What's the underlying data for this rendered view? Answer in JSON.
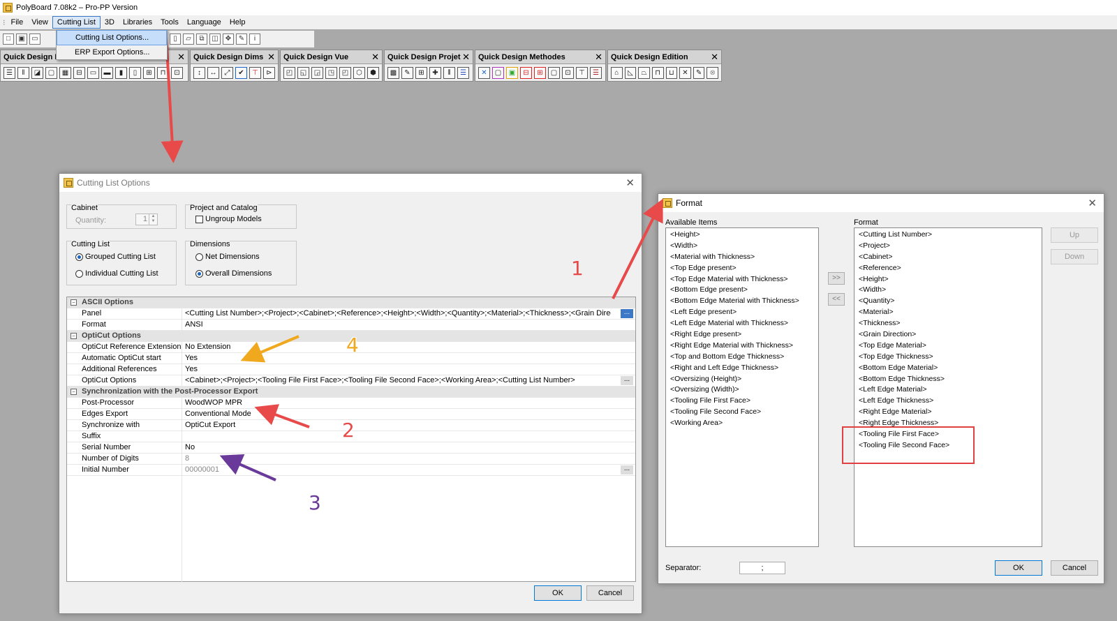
{
  "app": {
    "title": "PolyBoard 7.08k2 – Pro-PP Version"
  },
  "menu": {
    "items": [
      "File",
      "View",
      "Cutting List",
      "3D",
      "Libraries",
      "Tools",
      "Language",
      "Help"
    ],
    "open_menu_items": [
      "Cutting List Options...",
      "ERP Export Options..."
    ]
  },
  "quick_panels": [
    {
      "title": "Quick Design M",
      "icon_count": 13
    },
    {
      "title": "Quick Design Dims",
      "icon_count": 6
    },
    {
      "title": "Quick Design Vue",
      "icon_count": 7
    },
    {
      "title": "Quick Design Projet",
      "icon_count": 6
    },
    {
      "title": "Quick Design Methodes",
      "icon_count": 9
    },
    {
      "title": "Quick Design Edition",
      "icon_count": 8
    }
  ],
  "cutting_dialog": {
    "title": "Cutting List Options",
    "cabinet": {
      "group": "Cabinet",
      "quantity_label": "Quantity:",
      "quantity_value": "1"
    },
    "project_catalog": {
      "group": "Project and Catalog",
      "ungroup_label": "Ungroup Models"
    },
    "cutting_list": {
      "group": "Cutting List",
      "grouped": "Grouped Cutting List",
      "individual": "Individual Cutting List"
    },
    "dimensions": {
      "group": "Dimensions",
      "net": "Net Dimensions",
      "overall": "Overall Dimensions"
    },
    "grid": [
      {
        "section": "ASCII Options"
      },
      {
        "name": "Panel",
        "value": "<Cutting List Number>;<Project>;<Cabinet>;<Reference>;<Height>;<Width>;<Quantity>;<Material>;<Thickness>;<Grain Direct...",
        "dots": "...",
        "dots_blue": true
      },
      {
        "name": "Format",
        "value": "ANSI"
      },
      {
        "section": "OptiCut Options"
      },
      {
        "name": "OptiCut Reference Extension",
        "value": "No Extension"
      },
      {
        "name": "Automatic OptiCut start",
        "value": "Yes"
      },
      {
        "name": "Additional References",
        "value": "Yes"
      },
      {
        "name": "OptiCut Options",
        "value": "<Cabinet>;<Project>;<Tooling File First Face>;<Tooling File Second Face>;<Working Area>;<Cutting List Number>",
        "dots": "..."
      },
      {
        "section": "Synchronization with the Post-Processor Export"
      },
      {
        "name": "Post-Processor",
        "value": "WoodWOP MPR"
      },
      {
        "name": "Edges Export",
        "value": "Conventional Mode"
      },
      {
        "name": "Synchronize with",
        "value": "OptiCut Export"
      },
      {
        "name": "Suffix",
        "value": ""
      },
      {
        "name": "Serial Number",
        "value": "No"
      },
      {
        "name": "Number of Digits",
        "value": "8",
        "gray": true
      },
      {
        "name": "Initial Number",
        "value": "00000001",
        "gray": true,
        "dots": "..."
      }
    ],
    "ok": "OK",
    "cancel": "Cancel"
  },
  "format_dialog": {
    "title": "Format",
    "available_label": "Available Items",
    "available_items": [
      "<Height>",
      "<Width>",
      "<Material with Thickness>",
      "<Top Edge present>",
      "<Top Edge Material with Thickness>",
      "<Bottom Edge present>",
      "<Bottom Edge Material with Thickness>",
      "<Left Edge present>",
      "<Left Edge Material with Thickness>",
      "<Right Edge present>",
      "<Right Edge Material with Thickness>",
      "<Top and Bottom Edge Thickness>",
      "<Right and Left Edge Thickness>",
      "<Oversizing (Height)>",
      "<Oversizing (Width)>",
      "<Tooling File First Face>",
      "<Tooling File Second Face>",
      "<Working Area>"
    ],
    "format_label": "Format",
    "format_items": [
      "<Cutting List Number>",
      "<Project>",
      "<Cabinet>",
      "<Reference>",
      "<Height>",
      "<Width>",
      "<Quantity>",
      "<Material>",
      "<Thickness>",
      "<Grain Direction>",
      "<Top Edge Material>",
      "<Top Edge Thickness>",
      "<Bottom Edge Material>",
      "<Bottom Edge Thickness>",
      "<Left Edge Material>",
      "<Left Edge Thickness>",
      "<Right Edge Material>",
      "<Right Edge Thickness>",
      "<Tooling File First Face>",
      "<Tooling File Second Face>"
    ],
    "add_btn": ">>",
    "remove_btn": "<<",
    "up_btn": "Up",
    "down_btn": "Down",
    "separator_label": "Separator:",
    "separator_value": ";",
    "ok": "OK",
    "cancel": "Cancel"
  },
  "annotations": {
    "labels": [
      "1",
      "2",
      "3",
      "4"
    ],
    "colors": {
      "red": "#e84a4a",
      "orange": "#f0a81e",
      "purple": "#6a3a9a"
    }
  }
}
